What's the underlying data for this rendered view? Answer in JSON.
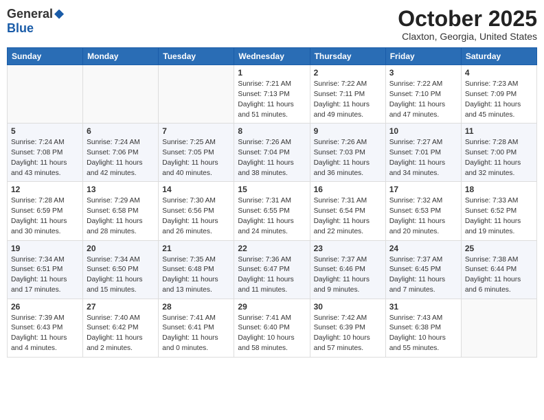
{
  "header": {
    "logo_general": "General",
    "logo_blue": "Blue",
    "month_title": "October 2025",
    "location": "Claxton, Georgia, United States"
  },
  "columns": [
    "Sunday",
    "Monday",
    "Tuesday",
    "Wednesday",
    "Thursday",
    "Friday",
    "Saturday"
  ],
  "weeks": [
    [
      {
        "num": "",
        "info": ""
      },
      {
        "num": "",
        "info": ""
      },
      {
        "num": "",
        "info": ""
      },
      {
        "num": "1",
        "info": "Sunrise: 7:21 AM\nSunset: 7:13 PM\nDaylight: 11 hours\nand 51 minutes."
      },
      {
        "num": "2",
        "info": "Sunrise: 7:22 AM\nSunset: 7:11 PM\nDaylight: 11 hours\nand 49 minutes."
      },
      {
        "num": "3",
        "info": "Sunrise: 7:22 AM\nSunset: 7:10 PM\nDaylight: 11 hours\nand 47 minutes."
      },
      {
        "num": "4",
        "info": "Sunrise: 7:23 AM\nSunset: 7:09 PM\nDaylight: 11 hours\nand 45 minutes."
      }
    ],
    [
      {
        "num": "5",
        "info": "Sunrise: 7:24 AM\nSunset: 7:08 PM\nDaylight: 11 hours\nand 43 minutes."
      },
      {
        "num": "6",
        "info": "Sunrise: 7:24 AM\nSunset: 7:06 PM\nDaylight: 11 hours\nand 42 minutes."
      },
      {
        "num": "7",
        "info": "Sunrise: 7:25 AM\nSunset: 7:05 PM\nDaylight: 11 hours\nand 40 minutes."
      },
      {
        "num": "8",
        "info": "Sunrise: 7:26 AM\nSunset: 7:04 PM\nDaylight: 11 hours\nand 38 minutes."
      },
      {
        "num": "9",
        "info": "Sunrise: 7:26 AM\nSunset: 7:03 PM\nDaylight: 11 hours\nand 36 minutes."
      },
      {
        "num": "10",
        "info": "Sunrise: 7:27 AM\nSunset: 7:01 PM\nDaylight: 11 hours\nand 34 minutes."
      },
      {
        "num": "11",
        "info": "Sunrise: 7:28 AM\nSunset: 7:00 PM\nDaylight: 11 hours\nand 32 minutes."
      }
    ],
    [
      {
        "num": "12",
        "info": "Sunrise: 7:28 AM\nSunset: 6:59 PM\nDaylight: 11 hours\nand 30 minutes."
      },
      {
        "num": "13",
        "info": "Sunrise: 7:29 AM\nSunset: 6:58 PM\nDaylight: 11 hours\nand 28 minutes."
      },
      {
        "num": "14",
        "info": "Sunrise: 7:30 AM\nSunset: 6:56 PM\nDaylight: 11 hours\nand 26 minutes."
      },
      {
        "num": "15",
        "info": "Sunrise: 7:31 AM\nSunset: 6:55 PM\nDaylight: 11 hours\nand 24 minutes."
      },
      {
        "num": "16",
        "info": "Sunrise: 7:31 AM\nSunset: 6:54 PM\nDaylight: 11 hours\nand 22 minutes."
      },
      {
        "num": "17",
        "info": "Sunrise: 7:32 AM\nSunset: 6:53 PM\nDaylight: 11 hours\nand 20 minutes."
      },
      {
        "num": "18",
        "info": "Sunrise: 7:33 AM\nSunset: 6:52 PM\nDaylight: 11 hours\nand 19 minutes."
      }
    ],
    [
      {
        "num": "19",
        "info": "Sunrise: 7:34 AM\nSunset: 6:51 PM\nDaylight: 11 hours\nand 17 minutes."
      },
      {
        "num": "20",
        "info": "Sunrise: 7:34 AM\nSunset: 6:50 PM\nDaylight: 11 hours\nand 15 minutes."
      },
      {
        "num": "21",
        "info": "Sunrise: 7:35 AM\nSunset: 6:48 PM\nDaylight: 11 hours\nand 13 minutes."
      },
      {
        "num": "22",
        "info": "Sunrise: 7:36 AM\nSunset: 6:47 PM\nDaylight: 11 hours\nand 11 minutes."
      },
      {
        "num": "23",
        "info": "Sunrise: 7:37 AM\nSunset: 6:46 PM\nDaylight: 11 hours\nand 9 minutes."
      },
      {
        "num": "24",
        "info": "Sunrise: 7:37 AM\nSunset: 6:45 PM\nDaylight: 11 hours\nand 7 minutes."
      },
      {
        "num": "25",
        "info": "Sunrise: 7:38 AM\nSunset: 6:44 PM\nDaylight: 11 hours\nand 6 minutes."
      }
    ],
    [
      {
        "num": "26",
        "info": "Sunrise: 7:39 AM\nSunset: 6:43 PM\nDaylight: 11 hours\nand 4 minutes."
      },
      {
        "num": "27",
        "info": "Sunrise: 7:40 AM\nSunset: 6:42 PM\nDaylight: 11 hours\nand 2 minutes."
      },
      {
        "num": "28",
        "info": "Sunrise: 7:41 AM\nSunset: 6:41 PM\nDaylight: 11 hours\nand 0 minutes."
      },
      {
        "num": "29",
        "info": "Sunrise: 7:41 AM\nSunset: 6:40 PM\nDaylight: 10 hours\nand 58 minutes."
      },
      {
        "num": "30",
        "info": "Sunrise: 7:42 AM\nSunset: 6:39 PM\nDaylight: 10 hours\nand 57 minutes."
      },
      {
        "num": "31",
        "info": "Sunrise: 7:43 AM\nSunset: 6:38 PM\nDaylight: 10 hours\nand 55 minutes."
      },
      {
        "num": "",
        "info": ""
      }
    ]
  ]
}
